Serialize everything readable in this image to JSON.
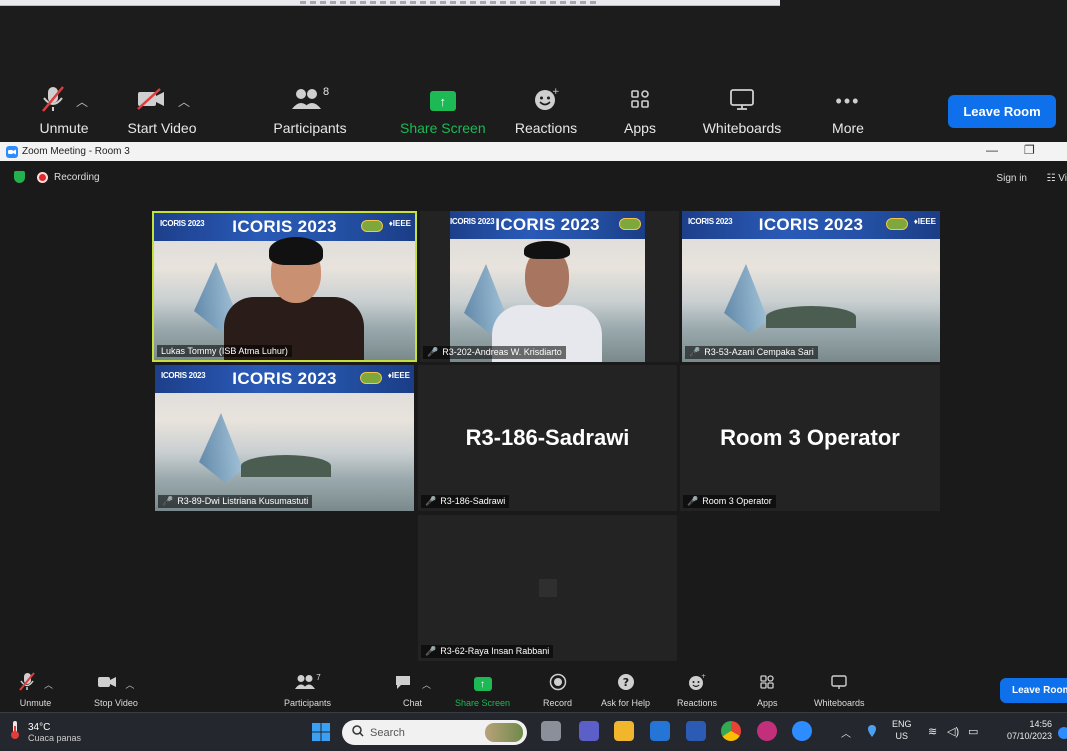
{
  "outer_toolbar": {
    "unmute": "Unmute",
    "start_video": "Start Video",
    "participants": "Participants",
    "participants_count": "8",
    "share_screen": "Share Screen",
    "reactions": "Reactions",
    "apps": "Apps",
    "whiteboards": "Whiteboards",
    "more": "More",
    "leave_room": "Leave Room"
  },
  "window": {
    "title": "Zoom Meeting - Room 3",
    "minimize": "—",
    "maximize": "❐"
  },
  "meeting": {
    "recording": "Recording",
    "sign_in": "Sign in",
    "view": "Vi"
  },
  "banner": {
    "title": "ICORIS 2023",
    "small_logo": "ICORIS 2023",
    "ieee": "♦IEEE"
  },
  "tiles": [
    {
      "name": "Lukas Tommy (ISB Atma Luhur)",
      "muted": false
    },
    {
      "name": "R3-202-Andreas W. Krisdiarto",
      "muted": true
    },
    {
      "name": "R3-53-Azani Cempaka Sari",
      "muted": true
    },
    {
      "name": "R3-89-Dwi Listriana Kusumastuti",
      "muted": true
    },
    {
      "name": "R3-186-Sadrawi",
      "big": "R3-186-Sadrawi",
      "muted": true
    },
    {
      "name": "Room 3 Operator",
      "big": "Room 3 Operator",
      "muted": true
    },
    {
      "name": "R3-62-Raya Insan Rabbani",
      "muted": true
    }
  ],
  "bottom_toolbar": {
    "unmute": "Unmute",
    "stop_video": "Stop Video",
    "participants": "Participants",
    "participants_count": "7",
    "chat": "Chat",
    "share_screen": "Share Screen",
    "record": "Record",
    "ask_for_help": "Ask for Help",
    "reactions": "Reactions",
    "apps": "Apps",
    "whiteboards": "Whiteboards",
    "leave_room": "Leave Room"
  },
  "taskbar": {
    "weather_temp": "34°C",
    "weather_desc": "Cuaca panas",
    "search_placeholder": "Search",
    "lang_top": "ENG",
    "lang_bottom": "US",
    "time": "14:56",
    "date": "07/10/2023"
  },
  "colors": {
    "accent_blue": "#0e71eb",
    "share_green": "#1db954",
    "active_speaker": "#c6e13b",
    "banner_blue": "#2451a5"
  }
}
